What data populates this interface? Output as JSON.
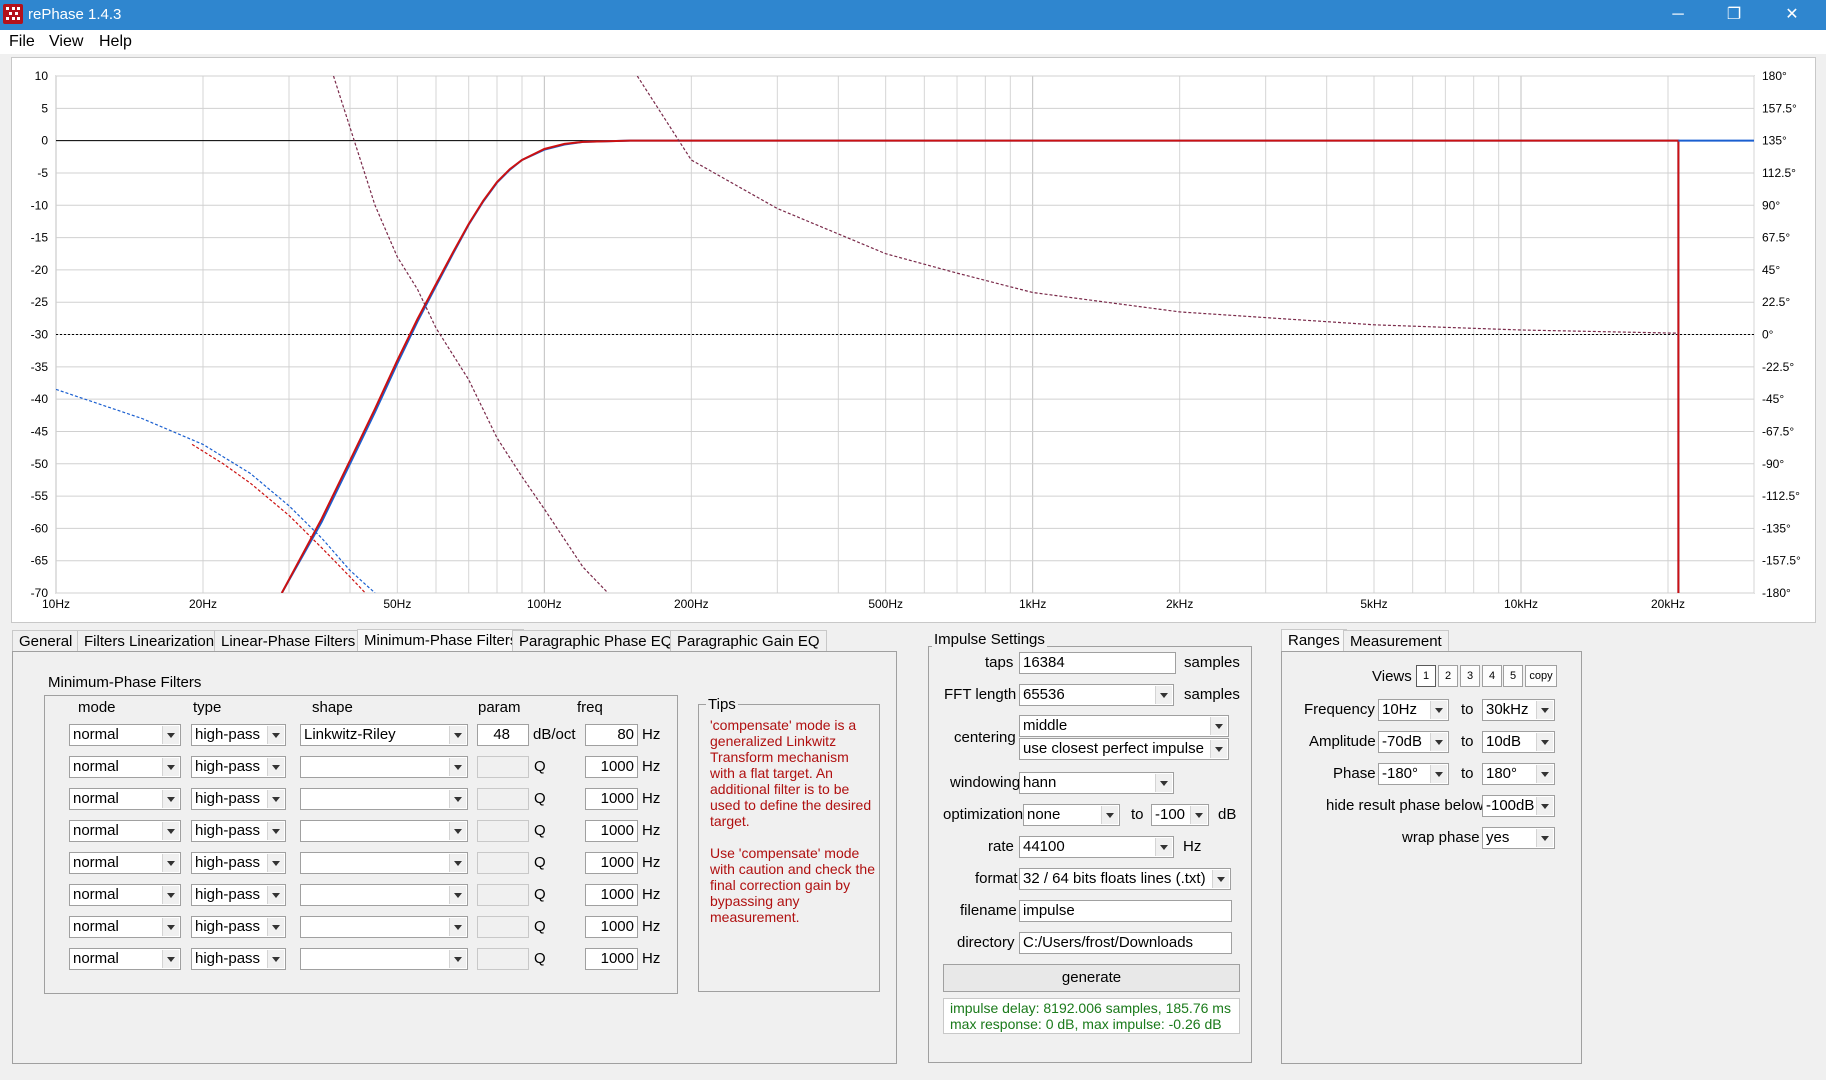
{
  "window": {
    "title": "rePhase 1.4.3",
    "controls": {
      "minimize": "─",
      "maximize": "❐",
      "close": "✕"
    }
  },
  "menu": [
    "File",
    "View",
    "Help"
  ],
  "chart_data": {
    "type": "line",
    "x_scale": "log",
    "xlim": [
      10,
      30000
    ],
    "ylim": [
      -70,
      10
    ],
    "y2lim": [
      -180,
      180
    ],
    "x_ticks": [
      "10Hz",
      "20Hz",
      "50Hz",
      "100Hz",
      "200Hz",
      "500Hz",
      "1kHz",
      "2kHz",
      "5kHz",
      "10kHz",
      "20kHz"
    ],
    "y_ticks": [
      "10",
      "5",
      "0",
      "-5",
      "-10",
      "-15",
      "-20",
      "-25",
      "-30",
      "-35",
      "-40",
      "-45",
      "-50",
      "-55",
      "-60",
      "-65",
      "-70"
    ],
    "y2_ticks": [
      "180°",
      "157.5°",
      "135°",
      "112.5°",
      "90°",
      "67.5°",
      "45°",
      "22.5°",
      "0°",
      "-22.5°",
      "-45°",
      "-67.5°",
      "-90°",
      "-112.5°",
      "-135°",
      "-157.5°",
      "-180°"
    ],
    "grid": true,
    "colors": {
      "result": "#cc1111",
      "target": "#1a5fd0",
      "reference": "#000000"
    },
    "series": [
      {
        "style": "solid",
        "color": "#1a5fd0",
        "points": [
          [
            29,
            -70
          ],
          [
            35,
            -59
          ],
          [
            40,
            -50
          ],
          [
            45,
            -42
          ],
          [
            50,
            -34.5
          ],
          [
            55,
            -28
          ],
          [
            60,
            -22.5
          ],
          [
            65,
            -17.5
          ],
          [
            70,
            -13
          ],
          [
            75,
            -9.4
          ],
          [
            80,
            -6.5
          ],
          [
            85,
            -4.5
          ],
          [
            90,
            -3
          ],
          [
            100,
            -1.4
          ],
          [
            110,
            -0.6
          ],
          [
            120,
            -0.2
          ],
          [
            150,
            0
          ],
          [
            21000,
            0
          ],
          [
            21000,
            -70
          ]
        ]
      },
      {
        "style": "solid",
        "color": "#cc1111",
        "points": [
          [
            29,
            -70
          ],
          [
            35,
            -58.5
          ],
          [
            40,
            -49.5
          ],
          [
            45,
            -41.5
          ],
          [
            50,
            -34
          ],
          [
            55,
            -27.6
          ],
          [
            60,
            -22.2
          ],
          [
            65,
            -17.3
          ],
          [
            70,
            -12.9
          ],
          [
            75,
            -9.3
          ],
          [
            80,
            -6.4
          ],
          [
            85,
            -4.4
          ],
          [
            90,
            -3
          ],
          [
            100,
            -1.3
          ],
          [
            110,
            -0.5
          ],
          [
            120,
            -0.2
          ],
          [
            150,
            0
          ],
          [
            21000,
            0
          ],
          [
            21000,
            -70
          ]
        ]
      },
      {
        "style": "dashed",
        "color": "#7a2a4a",
        "points": [
          [
            37,
            10
          ],
          [
            45,
            -10
          ],
          [
            50,
            -18
          ],
          [
            55,
            -23
          ],
          [
            60,
            -29
          ],
          [
            70,
            -37
          ],
          [
            80,
            -46
          ],
          [
            90,
            -52
          ],
          [
            100,
            -57
          ],
          [
            120,
            -66
          ],
          [
            135,
            -70
          ]
        ]
      },
      {
        "style": "dashed",
        "color": "#7a2a4a",
        "points": [
          [
            155,
            10
          ],
          [
            200,
            -3
          ],
          [
            300,
            -10.5
          ],
          [
            500,
            -17.5
          ],
          [
            700,
            -20.5
          ],
          [
            1000,
            -23.5
          ],
          [
            2000,
            -26.5
          ],
          [
            5000,
            -28.5
          ],
          [
            10000,
            -29.3
          ],
          [
            21000,
            -29.8
          ]
        ]
      },
      {
        "style": "dashed",
        "color": "#1a5fd0",
        "points": [
          [
            10,
            -38.5
          ],
          [
            15,
            -43
          ],
          [
            20,
            -47
          ],
          [
            25,
            -51.5
          ],
          [
            30,
            -56.5
          ],
          [
            35,
            -61.5
          ],
          [
            40,
            -66.5
          ],
          [
            45,
            -70
          ]
        ]
      },
      {
        "style": "dashed",
        "color": "#cc1111",
        "points": [
          [
            19,
            -47
          ],
          [
            22,
            -50
          ],
          [
            25,
            -53
          ],
          [
            30,
            -58
          ],
          [
            35,
            -63
          ],
          [
            40,
            -67.5
          ],
          [
            43,
            -70
          ]
        ]
      }
    ],
    "reference_lines": [
      {
        "y": 0,
        "style": "solid",
        "color": "#000000"
      },
      {
        "y": -30,
        "style": "dotted",
        "color": "#000000"
      }
    ]
  },
  "tabs": [
    "General",
    "Filters Linearization",
    "Linear-Phase Filters",
    "Minimum-Phase Filters",
    "Paragraphic Phase EQ",
    "Paragraphic Gain EQ"
  ],
  "active_tab": "Minimum-Phase Filters",
  "filters_panel": {
    "title": "Minimum-Phase Filters",
    "headers": {
      "mode": "mode",
      "type": "type",
      "shape": "shape",
      "param": "param",
      "freq": "freq"
    },
    "rows": [
      {
        "mode": "normal",
        "type": "high-pass",
        "shape": "Linkwitz-Riley",
        "param": "48",
        "param_unit": "dB/oct",
        "freq": "80",
        "unit": "Hz"
      },
      {
        "mode": "normal",
        "type": "high-pass",
        "shape": "",
        "param": "",
        "param_unit": "Q",
        "freq": "1000",
        "unit": "Hz"
      },
      {
        "mode": "normal",
        "type": "high-pass",
        "shape": "",
        "param": "",
        "param_unit": "Q",
        "freq": "1000",
        "unit": "Hz"
      },
      {
        "mode": "normal",
        "type": "high-pass",
        "shape": "",
        "param": "",
        "param_unit": "Q",
        "freq": "1000",
        "unit": "Hz"
      },
      {
        "mode": "normal",
        "type": "high-pass",
        "shape": "",
        "param": "",
        "param_unit": "Q",
        "freq": "1000",
        "unit": "Hz"
      },
      {
        "mode": "normal",
        "type": "high-pass",
        "shape": "",
        "param": "",
        "param_unit": "Q",
        "freq": "1000",
        "unit": "Hz"
      },
      {
        "mode": "normal",
        "type": "high-pass",
        "shape": "",
        "param": "",
        "param_unit": "Q",
        "freq": "1000",
        "unit": "Hz"
      },
      {
        "mode": "normal",
        "type": "high-pass",
        "shape": "",
        "param": "",
        "param_unit": "Q",
        "freq": "1000",
        "unit": "Hz"
      }
    ]
  },
  "tips": {
    "title": "Tips",
    "p1": "'compensate' mode is a generalized Linkwitz Transform mechanism with a flat target. An additional filter is to be used to define the desired target.",
    "p2": "Use 'compensate' mode with caution and check the final correction gain by bypassing any measurement.",
    "color": "#b01010"
  },
  "impulse": {
    "title": "Impulse Settings",
    "taps_label": "taps",
    "taps": "16384",
    "taps_unit": "samples",
    "fft_label": "FFT length",
    "fft": "65536",
    "fft_unit": "samples",
    "centering_label": "centering",
    "centering": "middle",
    "centering2": "use closest perfect impulse",
    "windowing_label": "windowing",
    "windowing": "hann",
    "optimization_label": "optimization",
    "optimization": "none",
    "opt_to": "to",
    "opt_value": "-100",
    "opt_unit": "dB",
    "rate_label": "rate",
    "rate": "44100",
    "rate_unit": "Hz",
    "format_label": "format",
    "format": "32 / 64 bits floats lines (.txt)",
    "filename_label": "filename",
    "filename": "impulse",
    "directory_label": "directory",
    "directory": "C:/Users/frost/Downloads",
    "generate": "generate",
    "status1": "impulse delay: 8192.006 samples, 185.76 ms",
    "status2": "max response: 0 dB, max impulse: -0.26 dB",
    "status_color": "#1a7a1a"
  },
  "ranges_tabs": [
    "Ranges",
    "Measurement"
  ],
  "ranges": {
    "views_label": "Views",
    "views": [
      "1",
      "2",
      "3",
      "4",
      "5",
      "copy"
    ],
    "to": "to",
    "frequency_label": "Frequency",
    "freq_from": "10Hz",
    "freq_to": "30kHz",
    "amplitude_label": "Amplitude",
    "amp_from": "-70dB",
    "amp_to": "10dB",
    "phase_label": "Phase",
    "phase_from": "-180°",
    "phase_to": "180°",
    "hide_label": "hide result phase below",
    "hide_value": "-100dB",
    "wrap_label": "wrap phase",
    "wrap_value": "yes"
  }
}
